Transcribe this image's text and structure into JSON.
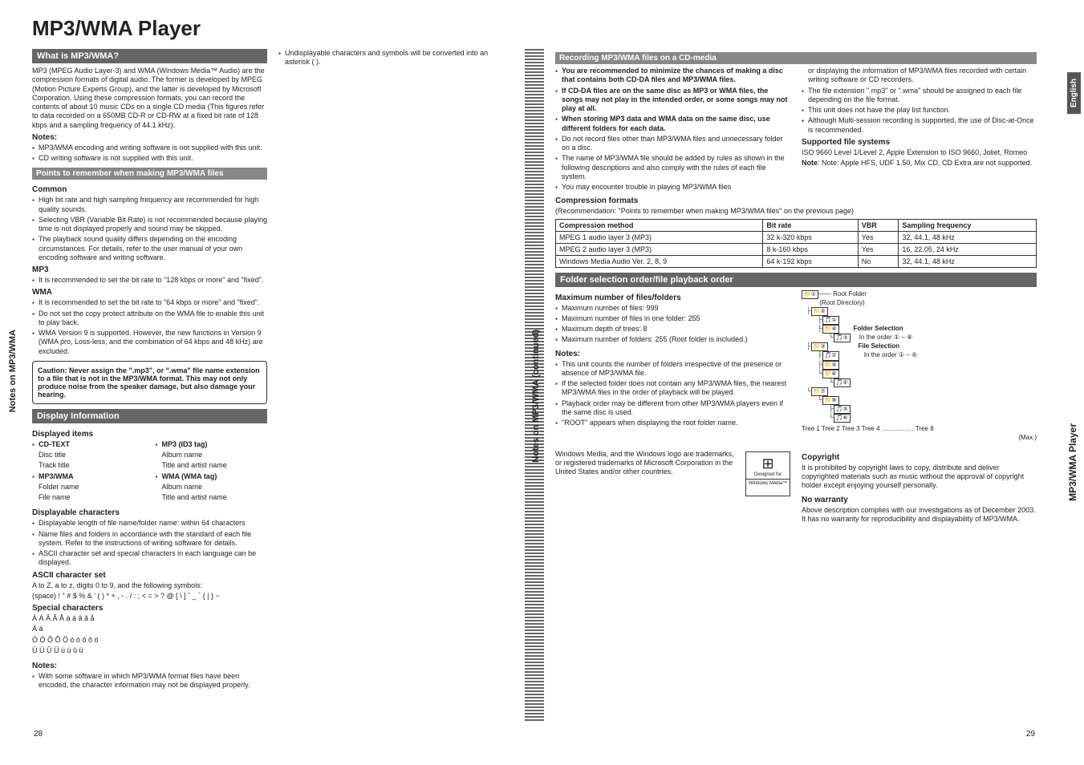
{
  "title": "MP3/WMA Player",
  "left": {
    "h1": {
      "title": "What is MP3/WMA?",
      "body": "MP3 (MPEG Audio Layer-3) and WMA (Windows Media™ Audio) are the compression formats of digital audio. The former is developed by MPEG (Motion Picture Experts Group), and the latter is developed by Microsoft Corporation. Using these compression formats, you can record the contents of about 10 music CDs on a single CD media (This figures refer to data recorded on a 650MB CD-R or CD-RW at a fixed bit rate of 128 kbps and a sampling frequency of 44.1 kHz).",
      "notes_h": "Notes:",
      "n1": "MP3/WMA encoding and writing software is not supplied with this unit.",
      "n2": "CD writing software is not supplied with this unit."
    },
    "h2": {
      "title": "Points to remember when making MP3/WMA files",
      "common_h": "Common",
      "c1": "High bit rate and high sampling frequency are recommended for high quality sounds.",
      "c2": "Selecting VBR (Variable Bit Rate) is not recommended because playing time is not displayed properly and sound may be skipped.",
      "c3": "The playback sound quality differs depending on the encoding circumstances. For details, refer to the user manual of your own encoding software and writing software.",
      "mp3_h": "MP3",
      "m1": "It is recommended to set the bit rate to \"128 kbps or more\" and \"fixed\".",
      "wma_h": "WMA",
      "w1": "It is recommended to set the bit rate to \"64 kbps or more\" and \"fixed\".",
      "w2": "Do not set the copy protect attribute on the WMA file to enable this unit to play back.",
      "w3": "WMA Version 9 is supported. However, the new functions in Version 9 (WMA pro, Loss-less, and the combination of 64 kbps and 48 kHz) are excluded."
    },
    "caution": "Caution: Never assign the \".mp3\", or \".wma\" file name extension to a file that is not in the MP3/WMA format. This may not only produce noise from the speaker damage, but also damage your hearing.",
    "h3": {
      "title": "Display Information",
      "di_h": "Displayed items",
      "cdtext": "CD-TEXT",
      "cdtext1": "Disc title",
      "cdtext2": "Track title",
      "mp3wma": "MP3/WMA",
      "mp3wma1": "Folder name",
      "mp3wma2": "File name",
      "id3": "MP3 (ID3 tag)",
      "id31": "Album name",
      "id32": "Title and artist name",
      "wtag": "WMA (WMA tag)",
      "wtag1": "Album name",
      "wtag2": "Title and artist name",
      "dc_h": "Displayable characters",
      "dc1": "Displayable length of file name/folder name: within 64 characters",
      "dc2": "Name files and folders in accordance with the standard of each file system. Refer to the instructions of writing software for details.",
      "dc3": "ASCII character set and special characters in each language can be displayed.",
      "ascii_h": "ASCII character set",
      "ascii1": "A to Z, a to z, digits 0 to 9, and the following symbols:",
      "ascii2": "(space) ! \" # $ % & ' ( )  * + , - . / : ; < = > ? @ [ \\ ] ˆ _ ` { | } ~",
      "spec_h": "Special characters",
      "spec1": "À Á Â Ã Å à á â ã å",
      "spec2": "Ä ä",
      "spec3": "Ò Ó Ô Õ Ö ò ó ô õ ö",
      "spec4": "Ù Ú Û Ü ù ú û ü",
      "nn_h": "Notes:",
      "nn1": "With some software in which MP3/WMA format files have been encoded, the character information may not be displayed properly.",
      "nn2": "Undisplayable characters and symbols will be converted into an asterisk ( )."
    },
    "tab": "Notes on MP3/WMA",
    "page": "28"
  },
  "right": {
    "rec": {
      "title": "Recording MP3/WMA files on a CD-media",
      "r1": "You are recommended to minimize the chances of making a disc that contains both CD-DA files and MP3/WMA files.",
      "r2": "If CD-DA files are on the same disc as MP3 or WMA files, the songs may not play in the intended order, or some songs may not play at all.",
      "r3": "When storing MP3 data and WMA data on the same disc, use different folders for each data.",
      "r4": "Do not record files other than MP3/WMA files and unnecessary folder on a disc.",
      "r5": "The name of MP3/WMA file should be added by rules as shown in the following descriptions and also comply with the rules of each file system.",
      "r6": "You may encounter trouble in playing MP3/WMA files",
      "r7": "or displaying the information of MP3/WMA files recorded with certain writing software or CD recorders.",
      "r8": "The file extension \".mp3\" or \".wma\" should be assigned to each file depending on the file format.",
      "r9": "This unit does not have the play list function.",
      "r10": "Although Multi-session recording is supported, the use of Disc-at-Once is recommended.",
      "sf_h": "Supported file systems",
      "sf1": "ISO 9660 Level 1/Level 2, Apple Extension to ISO 9660, Joliet, Romeo",
      "sf2": "Note: Apple HFS, UDF 1.50, Mix CD, CD Extra are not supported."
    },
    "comp_h": "Compression formats",
    "comp_p": "(Recommendation: \"Points to remember when making MP3/WMA files\" on the previous page)",
    "table": {
      "th1": "Compression method",
      "th2": "Bit rate",
      "th3": "VBR",
      "th4": "Sampling frequency",
      "r": [
        [
          "MPEG 1 audio layer 3 (MP3)",
          "32 k-320 kbps",
          "Yes",
          "32, 44.1, 48 kHz"
        ],
        [
          "MPEG 2 audio layer 3 (MP3)",
          "8 k-160 kbps",
          "Yes",
          "16, 22.05, 24 kHz"
        ],
        [
          "Windows Media Audio Ver. 2, 8, 9",
          "64 k-192 kbps",
          "No",
          "32, 44.1, 48 kHz"
        ]
      ]
    },
    "fold": {
      "title": "Folder selection order/file playback order",
      "max_h": "Maximum number of files/folders",
      "m1": "Maximum number of files: 999",
      "m2": "Maximum number of files in one folder: 255",
      "m3": "Maximum depth of trees: 8",
      "m4": "Maximum number of folders: 255 (Root folder is included.)",
      "nn_h": "Notes:",
      "n1": "This unit counts the number of folders irrespective of the presence or absence of MP3/WMA file.",
      "n2": "If the selected folder does not contain any MP3/WMA files, the nearest MP3/WMA files in the order of playback will be played.",
      "n3": "Playback order may be different from other MP3/WMA players even if the same disc is used.",
      "n4": "\"ROOT\" appears when displaying the root folder name.",
      "diag_root": "Root Folder",
      "diag_root2": "(Root Directory)",
      "diag_fs": "Folder Selection",
      "diag_fs2": "In the order ① – ⑧",
      "diag_fls": "File Selection",
      "diag_fls2": "In the order ① – ⑥",
      "diag_trees": "Tree 1    Tree 2    Tree 3    Tree 4 …………… Tree 8",
      "diag_max": "(Max.)"
    },
    "win": "Windows Media, and the Windows logo are trademarks, or registered trademarks of Microsoft Corporation in the United States and/or other countries.",
    "win_logo1": "Designed for",
    "win_logo2": "Windows Media™",
    "copy_h": "Copyright",
    "copy": "It is prohibited by copyright laws to copy, distribute and deliver copyrighted materials such as music without the approval of copyright holder except enjoying yourself personally.",
    "now_h": "No warranty",
    "now": "Above description complies with our investigations as of December 2003. It has no warranty for reproducibility and displayability of MP3/WMA.",
    "tab": "Notes on MP3/WMA (continued)",
    "tab_en": "English",
    "tab_player": "MP3/WMA Player",
    "page": "29"
  }
}
